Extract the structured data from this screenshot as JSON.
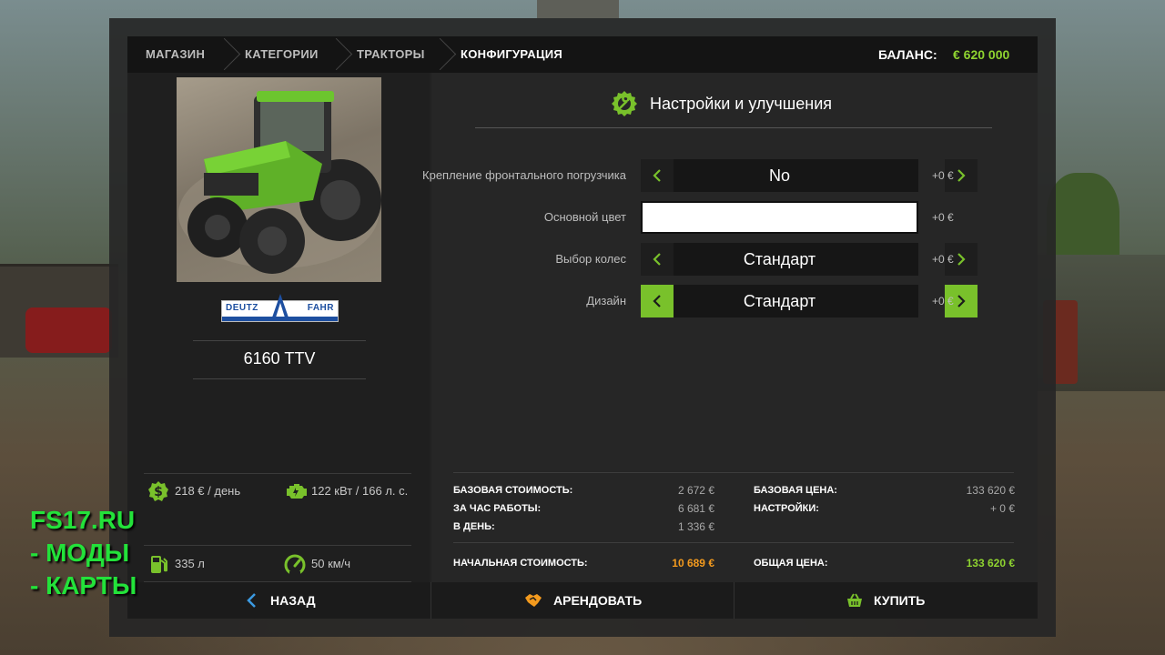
{
  "breadcrumbs": [
    "МАГАЗИН",
    "КАТЕГОРИИ",
    "ТРАКТОРЫ",
    "КОНФИГУРАЦИЯ"
  ],
  "balance": {
    "label": "БАЛАНС:",
    "value": "€ 620 000"
  },
  "vehicle": {
    "brand_left": "DEUTZ",
    "brand_right": "FAHR",
    "model": "6160 TTV"
  },
  "specs": {
    "maintenance": "218 € / день",
    "power": "122 кВт / 166 л. с.",
    "fuel": "335 л",
    "speed": "50 км/ч"
  },
  "section": {
    "title": "Настройки и улучшения",
    "icon": "gear-wrench-icon"
  },
  "options": [
    {
      "label": "Крепление фронтального погрузчика",
      "value": "No",
      "price": "+0 €"
    },
    {
      "label": "Основной цвет",
      "value": "",
      "price": "+0 €"
    },
    {
      "label": "Выбор колес",
      "value": "Стандарт",
      "price": "+0 €"
    },
    {
      "label": "Дизайн",
      "value": "Стандарт",
      "price": "+0 €"
    }
  ],
  "finance": {
    "base_cost_label": "БАЗОВАЯ СТОИМОСТЬ:",
    "base_cost": "2 672 €",
    "per_hour_label": "ЗА ЧАС РАБОТЫ:",
    "per_hour": "6 681 €",
    "per_day_label": "В ДЕНЬ:",
    "per_day": "1 336 €",
    "initial_cost_label": "НАЧАЛЬНАЯ СТОИМОСТЬ:",
    "initial_cost": "10 689 €",
    "base_price_label": "БАЗОВАЯ ЦЕНА:",
    "base_price": "133 620 €",
    "settings_label": "НАСТРОЙКИ:",
    "settings": "+ 0 €",
    "total_price_label": "ОБЩАЯ ЦЕНА:",
    "total_price": "133 620 €"
  },
  "buttons": {
    "back": "НАЗАД",
    "lease": "АРЕНДОВАТЬ",
    "buy": "КУПИТЬ"
  },
  "watermark": [
    "FS17.RU",
    "- МОДЫ",
    "- КАРТЫ"
  ],
  "colors": {
    "accent": "#79c12b",
    "balance": "#8fd430",
    "initial_cost": "#f39a1e",
    "watermark": "#23e23a"
  }
}
